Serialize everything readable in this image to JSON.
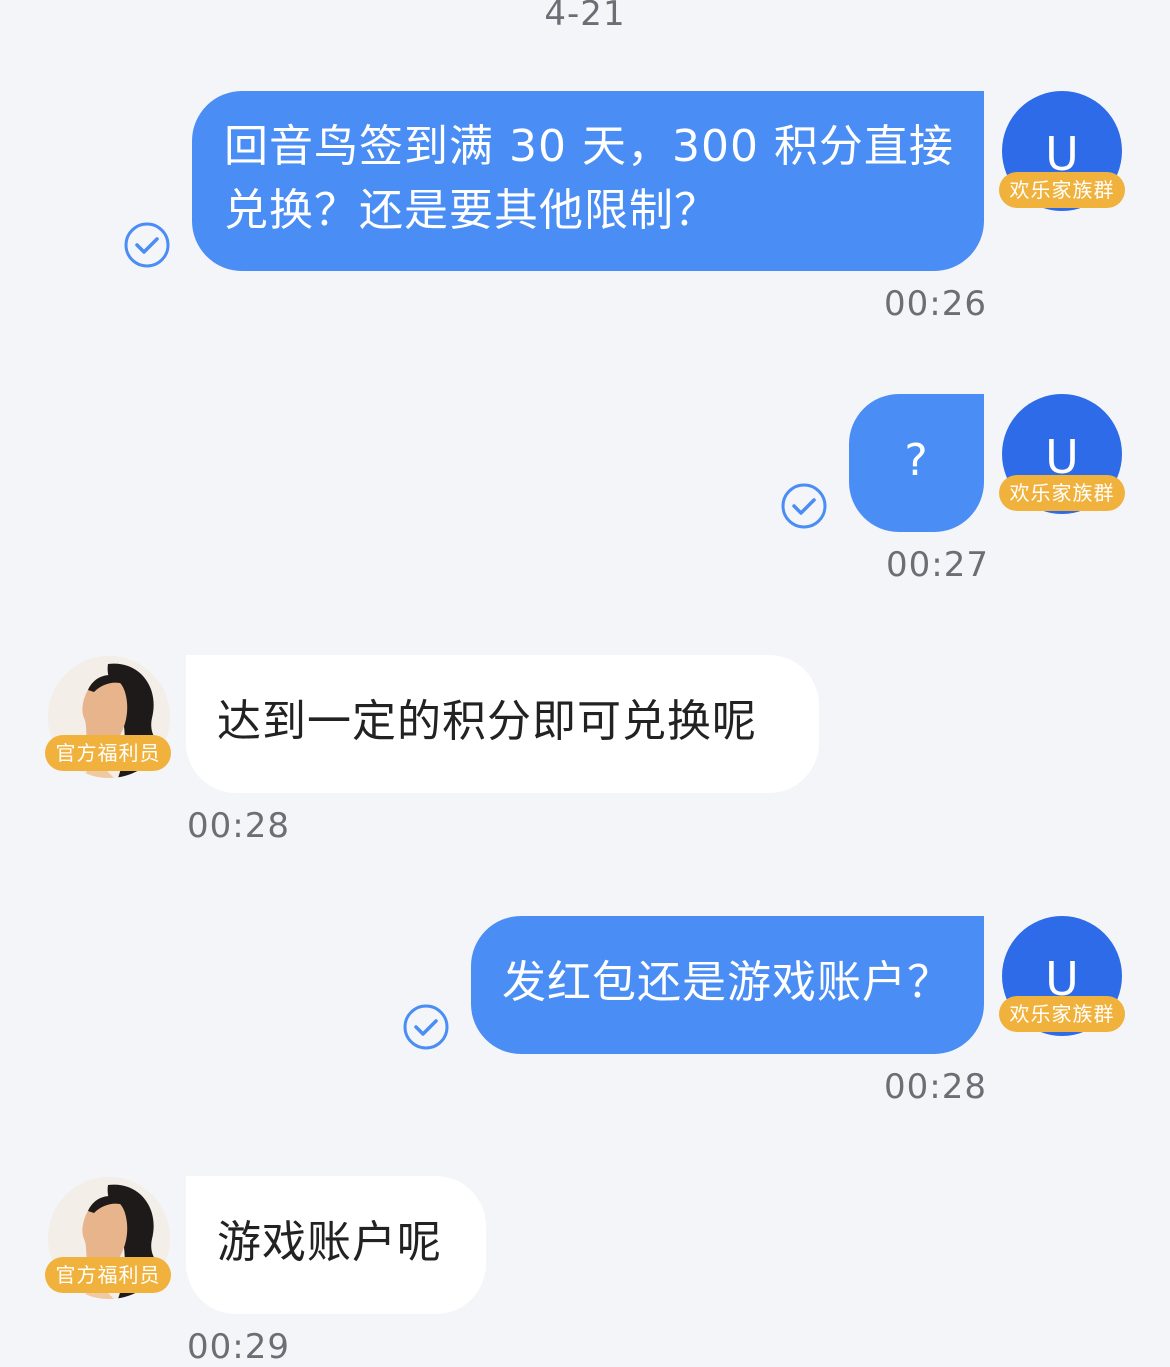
{
  "date_separator": "4-21",
  "messages": [
    {
      "direction": "out",
      "text_line1": "回音鸟签到满 30 天，300 积分直接",
      "text_line2": "兑换？还是要其他限制？",
      "time": "00:26",
      "avatar_letter": "U",
      "avatar_tag": "欢乐家族群"
    },
    {
      "direction": "out",
      "text": "?",
      "time": "00:27",
      "avatar_letter": "U",
      "avatar_tag": "欢乐家族群"
    },
    {
      "direction": "in",
      "text": "达到一定的积分即可兑换呢",
      "time": "00:28",
      "avatar_tag": "官方福利员"
    },
    {
      "direction": "out",
      "text": "发红包还是游戏账户？",
      "time": "00:28",
      "avatar_letter": "U",
      "avatar_tag": "欢乐家族群"
    },
    {
      "direction": "in",
      "text": "游戏账户呢",
      "time": "00:29",
      "avatar_tag": "官方福利员"
    }
  ],
  "colors": {
    "outgoing_bubble": "#4a8ef5",
    "incoming_bubble": "#ffffff",
    "avatar_u": "#2e6be8",
    "tag": "#f0b23c",
    "check": "#4a8ef5"
  }
}
